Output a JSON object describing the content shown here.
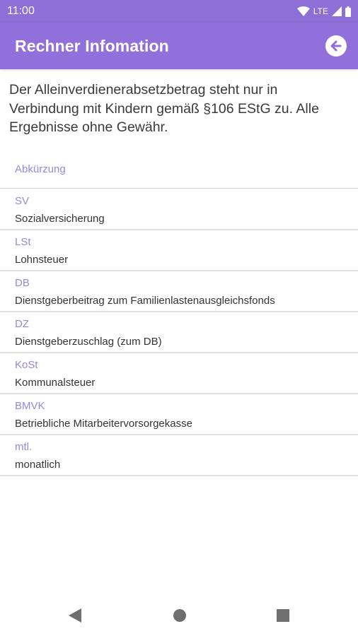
{
  "status_bar": {
    "time": "11:00",
    "network": "LTE"
  },
  "app_bar": {
    "title": "Rechner Infomation",
    "back_icon": "arrow-left-circle-icon"
  },
  "intro_text": "Der Alleinverdienerabsetzbetrag steht nur in Verbindung mit Kindern gemäß §106 EStG zu. Alle Ergebnisse ohne Gewähr.",
  "list_header": "Abkürzung",
  "items": [
    {
      "abbr": "SV",
      "desc": "Sozialversicherung"
    },
    {
      "abbr": "LSt",
      "desc": "Lohnsteuer"
    },
    {
      "abbr": "DB",
      "desc": "Dienstgeberbeitrag zum Familienlastenausgleichsfonds"
    },
    {
      "abbr": "DZ",
      "desc": "Dienstgeberzuschlag (zum DB)"
    },
    {
      "abbr": "KoSt",
      "desc": "Kommunalsteuer"
    },
    {
      "abbr": "BMVK",
      "desc": "Betriebliche Mitarbeitervorsorgekasse"
    },
    {
      "abbr": "mtl.",
      "desc": "monatlich"
    }
  ],
  "colors": {
    "primary": "#9270DB",
    "status_bar": "#8E6FD8",
    "accent_text": "#9A86DC"
  }
}
